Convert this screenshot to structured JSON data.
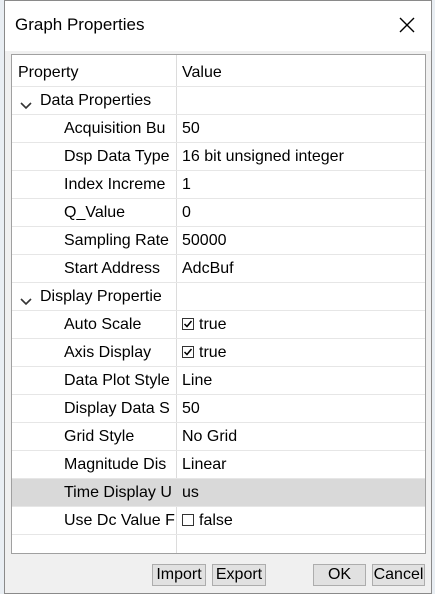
{
  "dialog": {
    "title": "Graph Properties"
  },
  "columns": {
    "property": "Property",
    "value": "Value"
  },
  "groups": [
    {
      "label": "Data Properties",
      "rows": [
        {
          "property": "Acquisition Bu",
          "value": "50"
        },
        {
          "property": "Dsp Data Type",
          "value": "16 bit unsigned integer"
        },
        {
          "property": "Index Increme",
          "value": "1"
        },
        {
          "property": "Q_Value",
          "value": "0"
        },
        {
          "property": "Sampling Rate",
          "value": "50000"
        },
        {
          "property": "Start Address",
          "value": "AdcBuf"
        }
      ]
    },
    {
      "label": "Display Propertie",
      "rows": [
        {
          "property": "Auto Scale",
          "value": "true",
          "checked": true
        },
        {
          "property": "Axis Display",
          "value": "true",
          "checked": true
        },
        {
          "property": "Data Plot Style",
          "value": "Line"
        },
        {
          "property": "Display Data S",
          "value": "50"
        },
        {
          "property": "Grid Style",
          "value": "No Grid"
        },
        {
          "property": "Magnitude Dis",
          "value": "Linear"
        },
        {
          "property": "Time Display U",
          "value": "us",
          "selected": true
        },
        {
          "property": "Use Dc Value F",
          "value": "false",
          "checked": false
        }
      ]
    }
  ],
  "buttons": {
    "import": "Import",
    "export": "Export",
    "ok": "OK",
    "cancel": "Cancel"
  }
}
